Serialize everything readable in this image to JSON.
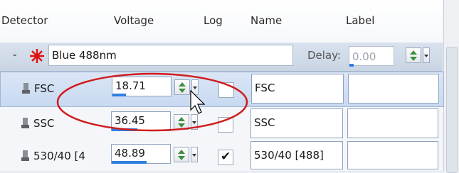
{
  "columns": {
    "detector": "Detector",
    "voltage": "Voltage",
    "log": "Log",
    "name": "Name",
    "label": "Label"
  },
  "laser_group": {
    "collapse_symbol": "-",
    "laser_name": "Blue 488nm",
    "delay_label": "Delay:",
    "delay_value": "0.00"
  },
  "rows": [
    {
      "detector": "FSC",
      "voltage": "18.71",
      "voltage_level": 0.19,
      "log": false,
      "name": "FSC",
      "label": "",
      "selected": true
    },
    {
      "detector": "SSC",
      "voltage": "36.45",
      "voltage_level": 0.36,
      "log": false,
      "name": "SSC",
      "label": "",
      "selected": false
    },
    {
      "detector": "530/40 [4",
      "voltage": "48.89",
      "voltage_level": 0.49,
      "log": true,
      "name": "530/40 [488]",
      "label": "",
      "selected": false
    }
  ],
  "colors": {
    "highlight_circle": "#d01c1c",
    "laser_star": "#e01010",
    "level_bar": "#2f7fe0"
  },
  "icons": {
    "detector": "detector-icon",
    "laser": "laser-star-icon",
    "cursor": "mouse-pointer-icon"
  }
}
